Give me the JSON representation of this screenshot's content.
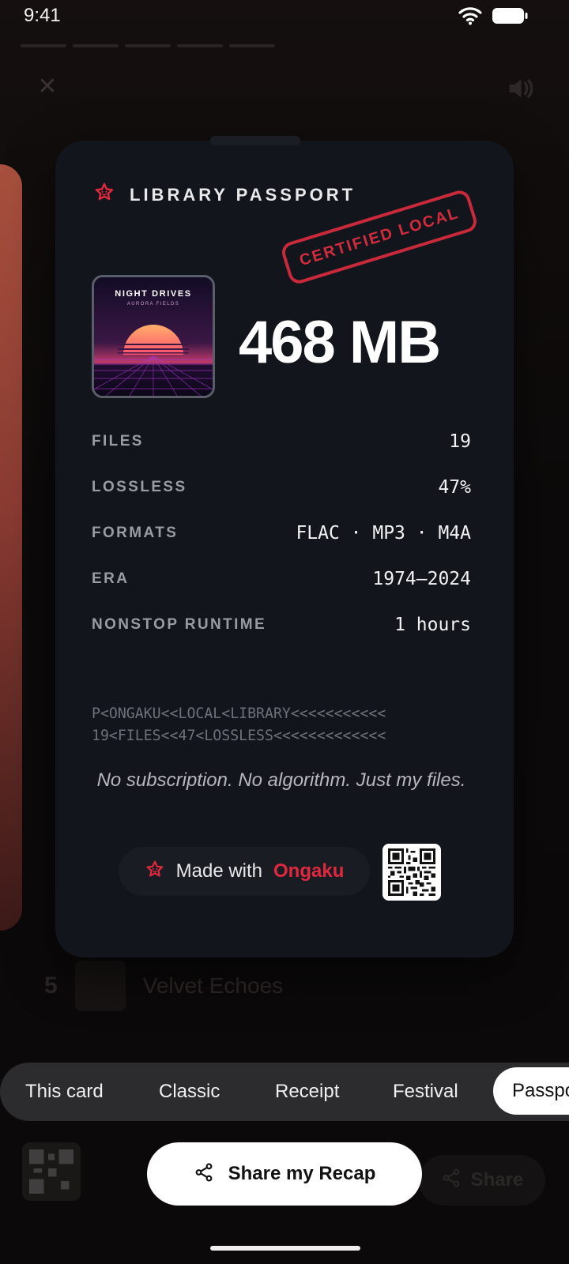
{
  "status_bar": {
    "time": "9:41"
  },
  "background": {
    "rows": [
      {
        "rank": "5",
        "name": "Velvet Echoes"
      }
    ]
  },
  "card": {
    "title": "LIBRARY PASSPORT",
    "stamp": "CERTIFIED LOCAL",
    "cover": {
      "title": "NIGHT DRIVES",
      "subtitle": "AURORA FIELDS"
    },
    "library_size": "468 MB",
    "stats": [
      {
        "label": "FILES",
        "value": "19"
      },
      {
        "label": "LOSSLESS",
        "value": "47%"
      },
      {
        "label": "FORMATS",
        "value": "FLAC · MP3 · M4A"
      },
      {
        "label": "ERA",
        "value": "1974–2024"
      },
      {
        "label": "NONSTOP RUNTIME",
        "value": "1 hours"
      }
    ],
    "mrz_lines": [
      "P<ONGAKU<<LOCAL<LIBRARY<<<<<<<<<<<",
      "19<FILES<<47<LOSSLESS<<<<<<<<<<<<<"
    ],
    "tagline": "No subscription. No algorithm. Just my files.",
    "made_with": {
      "prefix": "Made with",
      "brand": "Ongaku"
    }
  },
  "templates": {
    "tabs": [
      "This card",
      "Classic",
      "Receipt",
      "Festival",
      "Passport"
    ],
    "active": "Passport"
  },
  "actions": {
    "share_primary": "Share my Recap",
    "share_secondary": "Share"
  },
  "colors": {
    "accent": "#e0283f",
    "card_bg": "#12151b",
    "page_bg": "#0b0909"
  }
}
